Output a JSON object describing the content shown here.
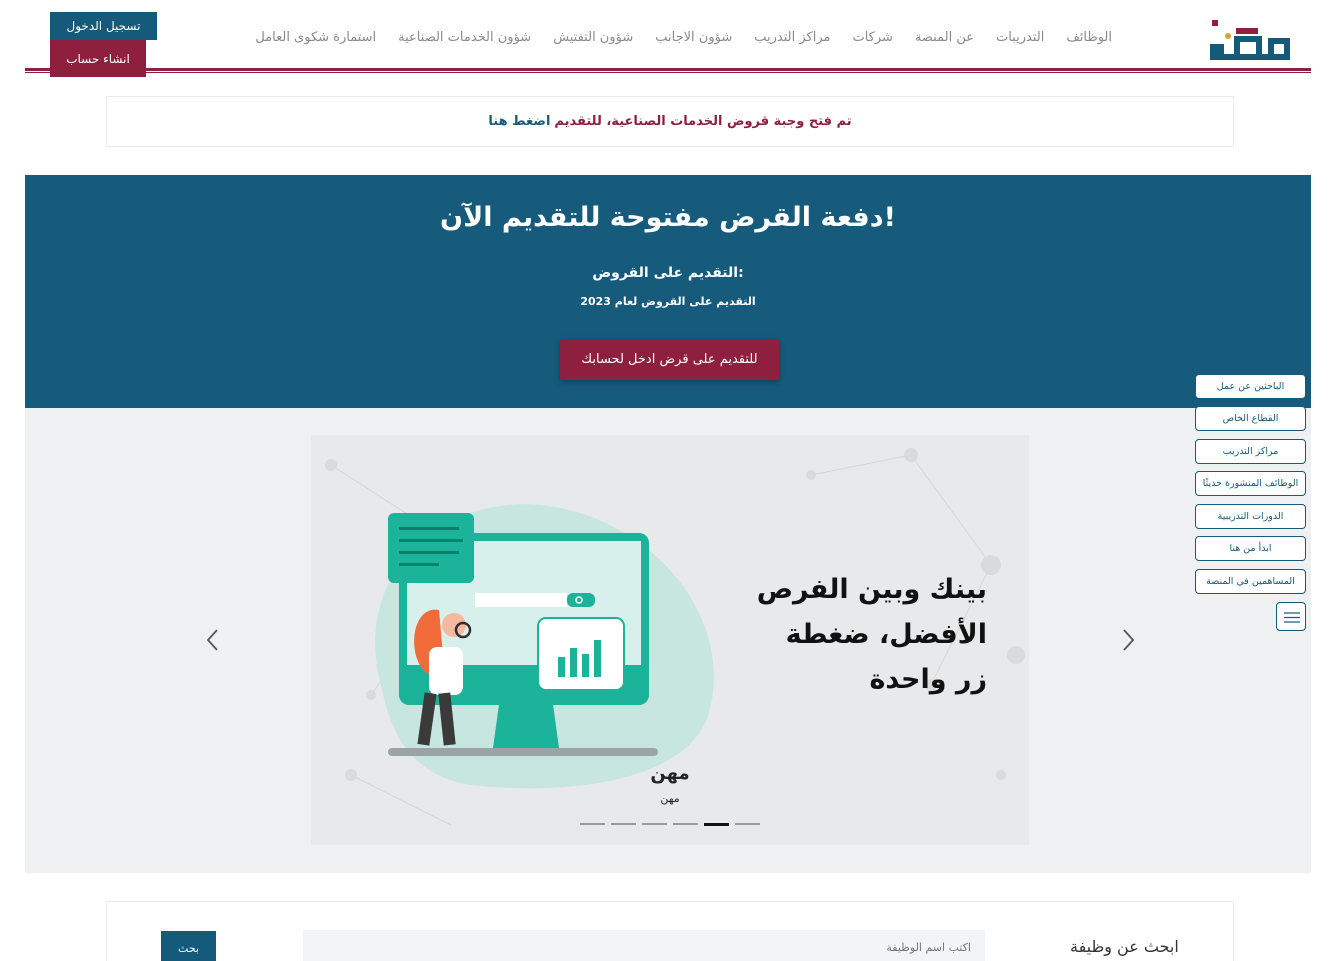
{
  "header": {
    "logo_text": "مهن",
    "nav": [
      "الوظائف",
      "التدريبات",
      "عن المنصة",
      "شركات",
      "مراكز التدريب",
      "شؤون الاجانب",
      "شؤون التفتيش",
      "شؤون الخدمات الصناعية",
      "استمارة شكوى العامل"
    ],
    "login_label": "تسجيل الدخول",
    "signup_label": "انشاء حساب"
  },
  "notice": {
    "text": "تم فتح وجبة قروض الخدمات الصناعية، للتقديم",
    "link": "اضغط هنا"
  },
  "banner": {
    "title": "دفعة القرض مفتوحة للتقديم الآن!",
    "subtitle": "التقديم على القروض:",
    "detail": "التقديم على القروض لعام 2023",
    "button": "للتقديم على قرض ادخل لحسابك"
  },
  "carousel": {
    "slide_text": [
      "بينك وبين الفرص",
      "الأفضل، ضغطة",
      "زر واحدة"
    ],
    "caption_title": "مهن",
    "caption_sub": "مهن",
    "total_slides": 6,
    "active_slide": 5
  },
  "side_menu": [
    "الباحثين عن عمل",
    "القطاع الخاص",
    "مراكز التدريب",
    "الوظائف المنشورة حديثًا",
    "الدورات التدريبية",
    "ابدأ من هنا",
    "المساهمين في المنصة"
  ],
  "job_search": {
    "title": "ابحث عن وظيفة",
    "placeholder": "اكتب اسم الوظيفة",
    "button": "بحث"
  },
  "colors": {
    "primary": "#155a7a",
    "accent": "#8e1f3f",
    "teal": "#1bb39a"
  }
}
